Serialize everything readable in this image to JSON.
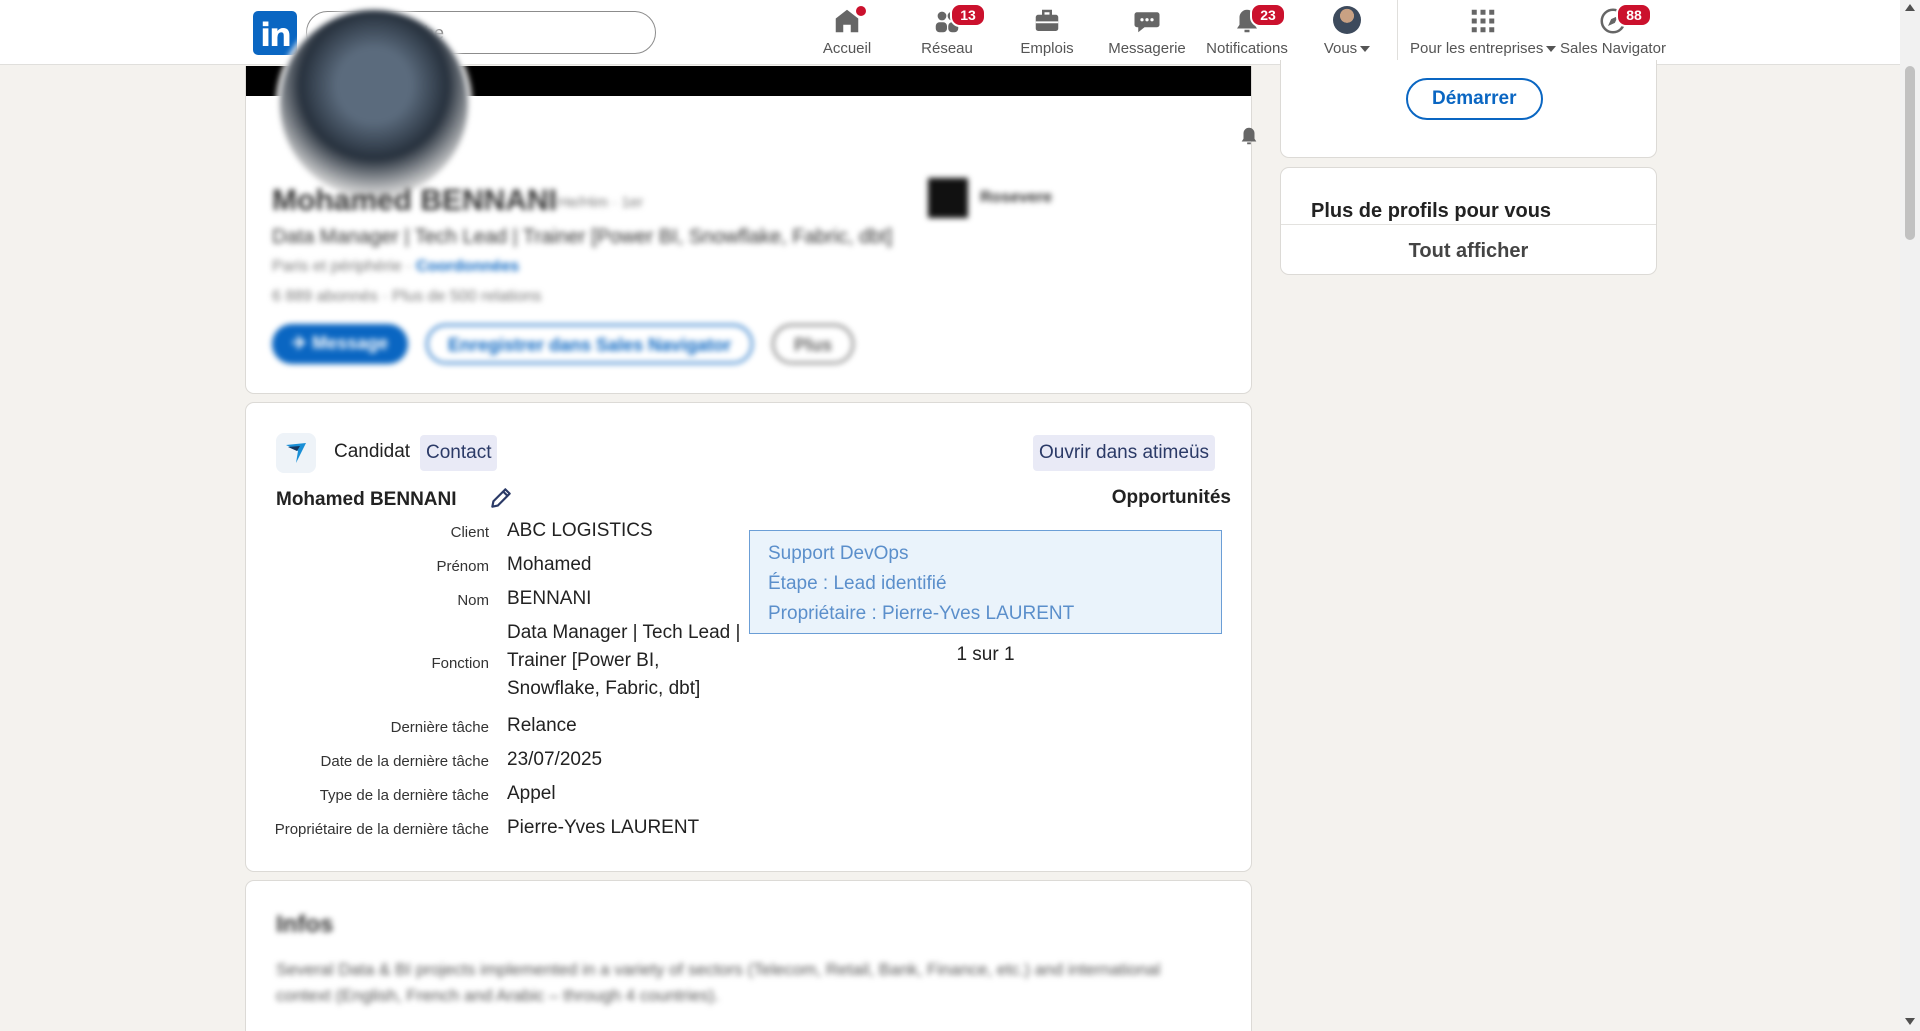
{
  "nav": {
    "search_placeholder": "Recherche",
    "items": [
      {
        "label": "Accueil",
        "icon": "home-icon",
        "badge": ""
      },
      {
        "label": "Réseau",
        "icon": "network-icon",
        "badge": "13"
      },
      {
        "label": "Emplois",
        "icon": "briefcase-icon",
        "badge": ""
      },
      {
        "label": "Messagerie",
        "icon": "messaging-icon",
        "badge": ""
      },
      {
        "label": "Notifications",
        "icon": "bell-icon",
        "badge": "23"
      },
      {
        "label": "Vous",
        "icon": "avatar",
        "badge": ""
      },
      {
        "label": "Pour les entreprises",
        "icon": "grid-icon",
        "badge": ""
      },
      {
        "label": "Sales Navigator",
        "icon": "compass-icon",
        "badge": "88"
      }
    ],
    "accent": "#0a66c2",
    "badge_color": "#cb112d"
  },
  "profile": {
    "name": "Mohamed BENNANI",
    "pronouns": "He/Him · 1er",
    "headline": "Data Manager | Tech Lead | Trainer [Power BI, Snowflake, Fabric, dbt]",
    "location": "Paris et périphérie · ",
    "location_link": "Coordonnées",
    "connections": "6 889 abonnés · Plus de 500 relations",
    "company": "Rosevere",
    "btn_message": "✈ Message",
    "btn_save": "Enregistrer dans Sales Navigator",
    "btn_more": "Plus"
  },
  "atimeus": {
    "tag_candidate": "Candidat",
    "tag_contact": "Contact",
    "open_button": "Ouvrir dans atimeüs",
    "name": "Mohamed BENNANI",
    "opportunities_title": "Opportunités",
    "fields": [
      {
        "label": "Client",
        "value": "ABC LOGISTICS"
      },
      {
        "label": "Prénom",
        "value": "Mohamed"
      },
      {
        "label": "Nom",
        "value": "BENNANI"
      },
      {
        "label": "Fonction",
        "value": "Data Manager | Tech Lead | Trainer [Power BI, Snowflake, Fabric, dbt]"
      },
      {
        "label": "Dernière tâche",
        "value": "Relance"
      },
      {
        "label": "Date de la dernière tâche",
        "value": "23/07/2025"
      },
      {
        "label": "Type de la dernière tâche",
        "value": "Appel"
      },
      {
        "label": "Propriétaire de la dernière tâche",
        "value": "Pierre-Yves LAURENT"
      }
    ],
    "opportunity": {
      "title": "Support DevOps",
      "stage": "Étape : Lead identifié",
      "owner": "Propriétaire : Pierre-Yves LAURENT"
    },
    "pager": "1 sur 1"
  },
  "infos": {
    "title": "Infos",
    "text": "Several Data & BI projects implemented in a variety of sectors (Telecom, Retail, Bank, Finance, etc.) and international context (English, French and Arabic – through 4 countries)."
  },
  "sidebar": {
    "start_button": "Démarrer",
    "more_profiles_title": "Plus de profils pour vous",
    "show_all": "Tout afficher"
  }
}
